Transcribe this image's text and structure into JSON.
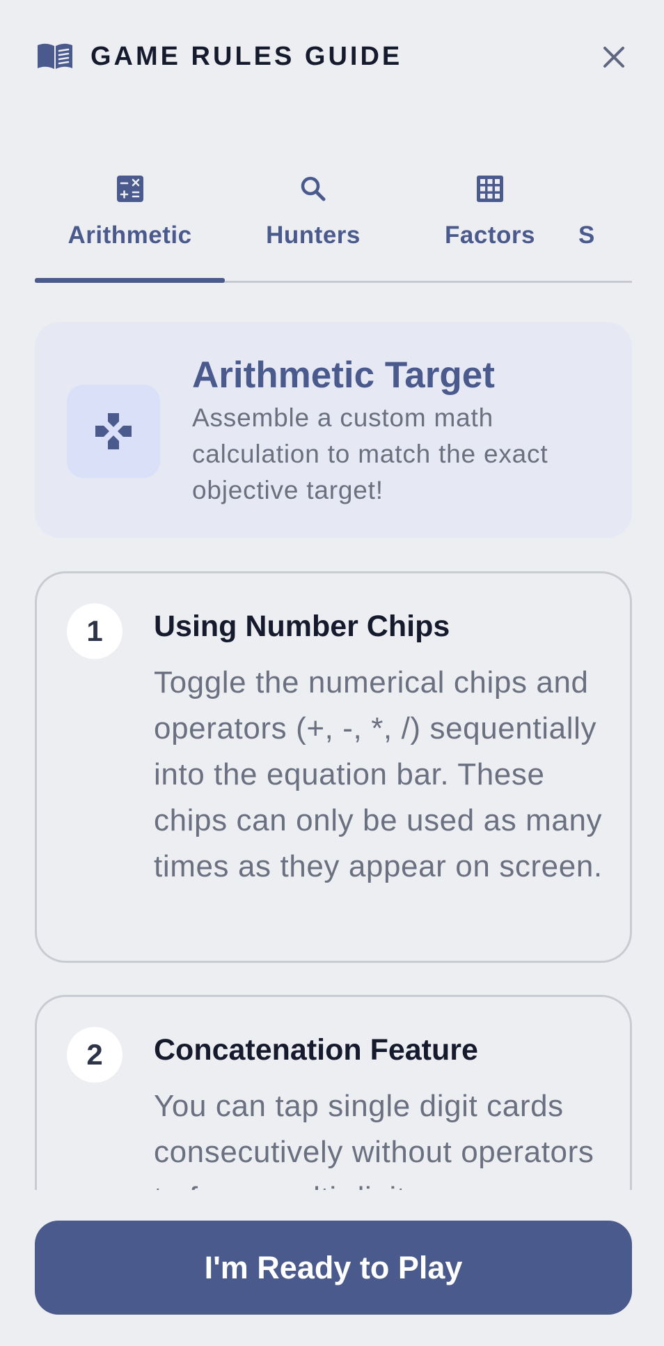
{
  "header": {
    "title": "GAME RULES GUIDE",
    "icon": "book-icon",
    "close_icon": "close-icon"
  },
  "tabs": [
    {
      "label": "Arithmetic",
      "icon": "calculator-icon",
      "active": true
    },
    {
      "label": "Hunters",
      "icon": "search-icon",
      "active": false
    },
    {
      "label": "Factors",
      "icon": "grid-icon",
      "active": false
    },
    {
      "label": "S",
      "icon": "",
      "active": false
    }
  ],
  "hero": {
    "title": "Arithmetic Target",
    "description": "Assemble a custom math calculation to match the exact objective target!",
    "icon": "gamepad-cross-icon"
  },
  "rules": [
    {
      "number": "1",
      "title": "Using Number Chips",
      "body": "Toggle the numerical chips and operators (+, -, *, /) sequentially into the equation bar. These chips can only be used as many times as they appear on screen."
    },
    {
      "number": "2",
      "title": "Concatenation Feature",
      "body": "You can tap single digit cards consecutively without operators to forge multi-digit"
    }
  ],
  "cta": {
    "label": "I'm Ready to Play"
  },
  "colors": {
    "accent": "#4a5a8c",
    "background": "#eceef2",
    "hero_bg": "#e6e9f4",
    "text_dark": "#151a2d",
    "text_muted": "#6a7080"
  }
}
